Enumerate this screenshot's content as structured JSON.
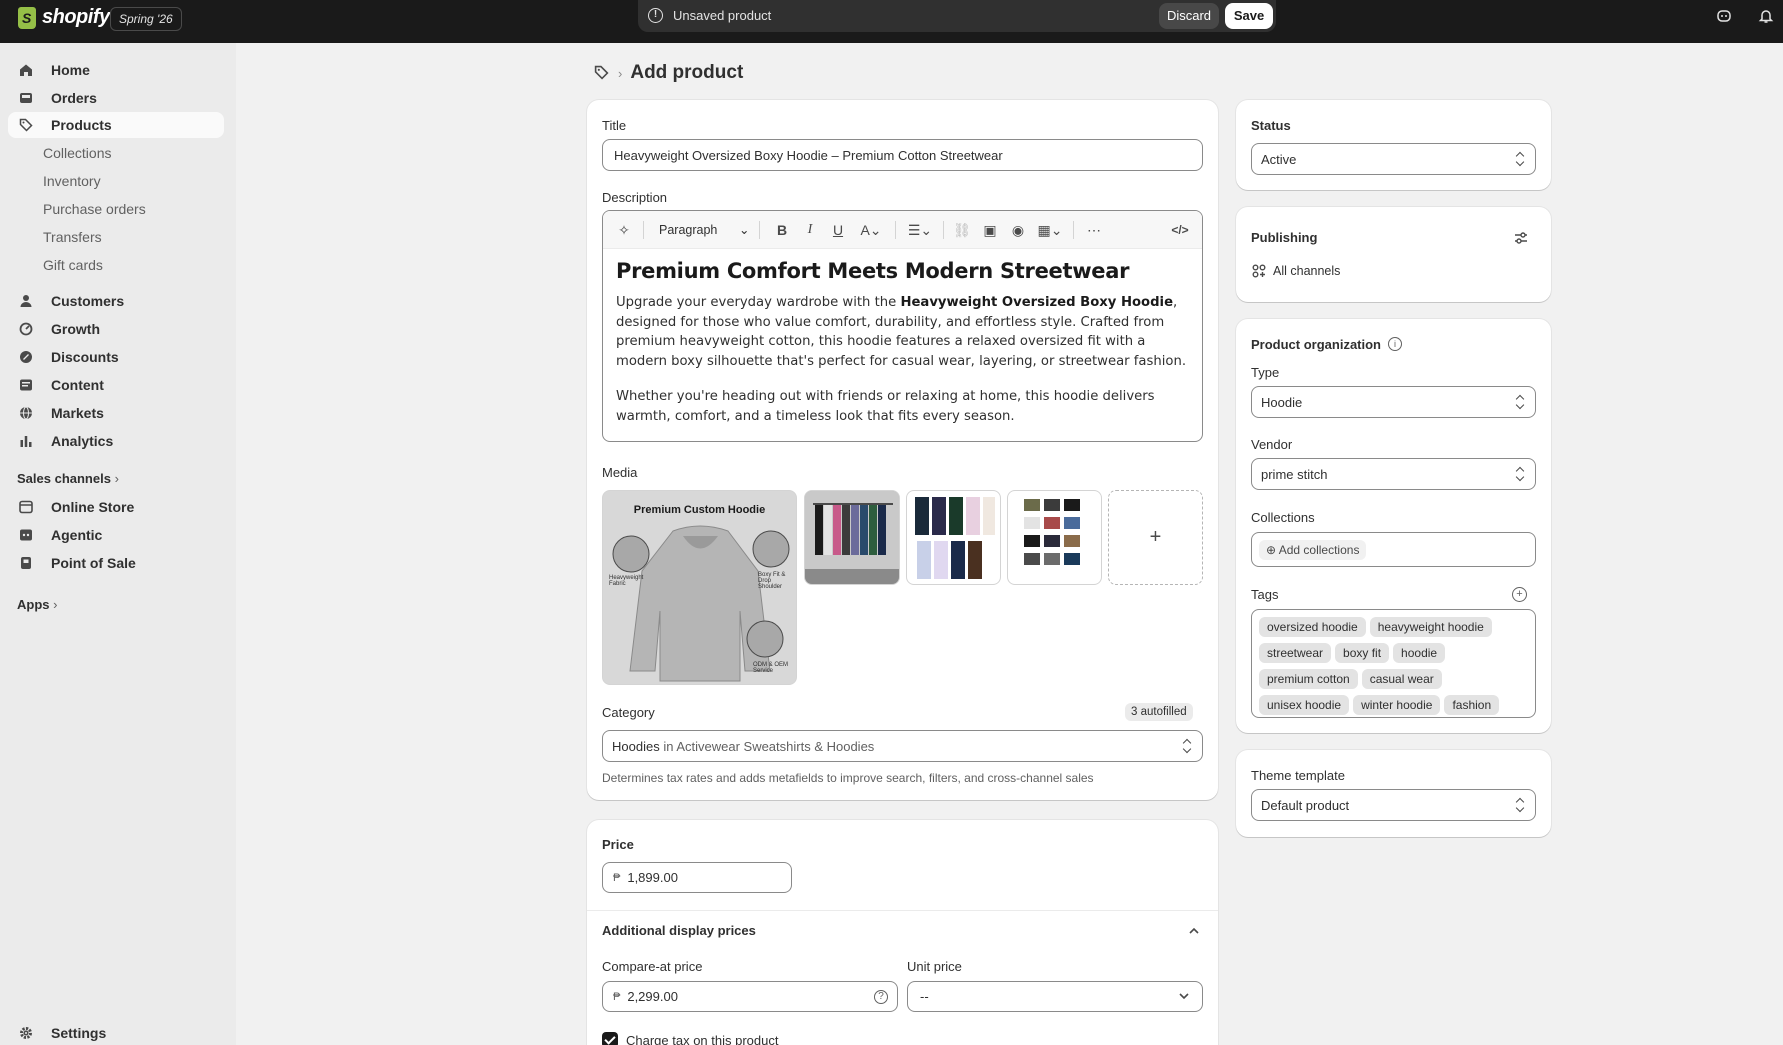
{
  "topbar": {
    "brand": "shopify",
    "edition": "Spring '26",
    "unsaved_message": "Unsaved product",
    "discard_label": "Discard",
    "save_label": "Save"
  },
  "sidebar": {
    "items": [
      {
        "label": "Home",
        "icon": "home-icon"
      },
      {
        "label": "Orders",
        "icon": "inbox-icon"
      },
      {
        "label": "Products",
        "icon": "tag-icon",
        "active": true
      },
      {
        "label": "Collections",
        "sub": true
      },
      {
        "label": "Inventory",
        "sub": true
      },
      {
        "label": "Purchase orders",
        "sub": true
      },
      {
        "label": "Transfers",
        "sub": true
      },
      {
        "label": "Gift cards",
        "sub": true
      },
      {
        "label": "Customers",
        "icon": "person-icon"
      },
      {
        "label": "Growth",
        "icon": "gauge-icon"
      },
      {
        "label": "Discounts",
        "icon": "discount-icon"
      },
      {
        "label": "Content",
        "icon": "content-icon"
      },
      {
        "label": "Markets",
        "icon": "globe-icon"
      },
      {
        "label": "Analytics",
        "icon": "bar-chart-icon"
      }
    ],
    "sales_channels_label": "Sales channels",
    "channels": [
      {
        "label": "Online Store",
        "icon": "store-icon"
      },
      {
        "label": "Agentic",
        "icon": "agentic-icon"
      },
      {
        "label": "Point of Sale",
        "icon": "pos-icon"
      }
    ],
    "apps_label": "Apps",
    "settings_label": "Settings"
  },
  "page": {
    "title": "Add product"
  },
  "product": {
    "title_label": "Title",
    "title_value": "Heavyweight Oversized Boxy Hoodie – Premium Cotton Streetwear",
    "description_label": "Description",
    "paragraph_style": "Paragraph",
    "description_heading": "Premium Comfort Meets Modern Streetwear",
    "description_p1_before": "Upgrade your everyday wardrobe with the ",
    "description_p1_bold": "Heavyweight Oversized Boxy Hoodie",
    "description_p1_after": ", designed for those who value comfort, durability, and effortless style. Crafted from premium heavyweight cotton, this hoodie features a relaxed oversized fit with a modern boxy silhouette that's perfect for casual wear, layering, or streetwear fashion.",
    "description_p2": "Whether you're heading out with friends or relaxing at home, this hoodie delivers warmth, comfort, and a timeless look that fits every season.",
    "media_label": "Media",
    "media_main_caption": "Premium Custom Hoodie",
    "media_callout_1": "Heavyweight Fabric",
    "media_callout_2": "Boxy Fit & Drop Shoulder",
    "media_callout_3": "ODM & OEM Service",
    "add_media_symbol": "+",
    "category_label": "Category",
    "autofilled_badge": "3 autofilled",
    "category_name": "Hoodies",
    "category_path": " in Activewear Sweatshirts & Hoodies",
    "category_hint": "Determines tax rates and adds metafields to improve search, filters, and cross-channel sales"
  },
  "pricing": {
    "price_label": "Price",
    "currency_symbol": "₱",
    "price_value": "1,899.00",
    "additional_label": "Additional display prices",
    "compare_label": "Compare-at price",
    "compare_value": "2,299.00",
    "unit_price_label": "Unit price",
    "unit_price_value": "--",
    "charge_tax_label": "Charge tax on this product"
  },
  "status": {
    "label": "Status",
    "value": "Active"
  },
  "publishing": {
    "label": "Publishing",
    "channels": "All channels"
  },
  "organization": {
    "label": "Product organization",
    "type_label": "Type",
    "type_value": "Hoodie",
    "vendor_label": "Vendor",
    "vendor_value": "prime stitch",
    "collections_label": "Collections",
    "add_collections": "Add collections",
    "tags_label": "Tags",
    "tags": [
      "oversized hoodie",
      "heavyweight hoodie",
      "streetwear",
      "boxy fit",
      "hoodie",
      "premium cotton",
      "casual wear",
      "unisex hoodie",
      "winter hoodie",
      "fashion"
    ]
  },
  "theme": {
    "label": "Theme template",
    "value": "Default product"
  },
  "colors": {
    "topbar": "#1a1a1a",
    "sidebar": "#ebebeb",
    "canvas": "#f1f1f1",
    "save_button": "#ffffff",
    "accent_dark": "#303030"
  }
}
